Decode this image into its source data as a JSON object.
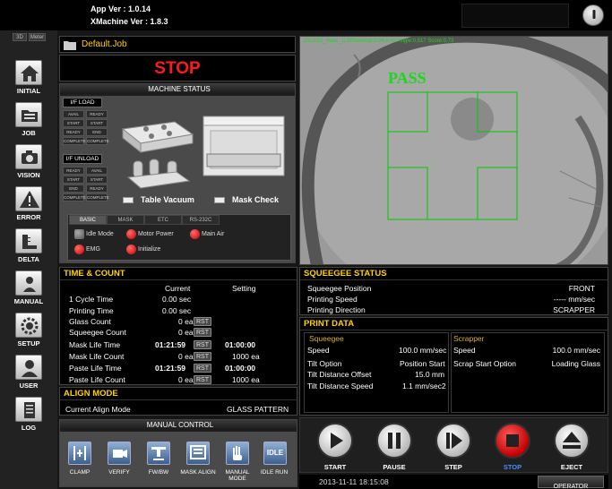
{
  "app": {
    "app_ver": "App Ver : 1.0.14",
    "xmachine_ver": "XMachine Ver : 1.8.3"
  },
  "nav": {
    "mini_tabs": [
      "3D",
      "Meter"
    ],
    "items": [
      {
        "label": "INITIAL",
        "icon": "home-icon"
      },
      {
        "label": "JOB",
        "icon": "folder-icon"
      },
      {
        "label": "VISION",
        "icon": "camera-icon"
      },
      {
        "label": "ERROR",
        "icon": "warning-icon"
      },
      {
        "label": "DELTA",
        "icon": "ruler-icon"
      },
      {
        "label": "MANUAL",
        "icon": "user-manual-icon"
      },
      {
        "label": "SETUP",
        "icon": "gear-icon"
      },
      {
        "label": "USER",
        "icon": "user-icon"
      },
      {
        "label": "LOG",
        "icon": "log-icon"
      }
    ]
  },
  "job": {
    "name": "Default.Job"
  },
  "machine": {
    "state": "STOP",
    "status_title": "MACHINE STATUS",
    "if_load": {
      "title": "I/F LOAD",
      "cells": [
        "AVAIL",
        "READY",
        "START",
        "START",
        "READY",
        "END",
        "COMPLETE",
        "COMPLETE"
      ]
    },
    "if_unload": {
      "title": "I/F UNLOAD",
      "cells": [
        "READY",
        "AVAIL",
        "START",
        "START",
        "END",
        "READY",
        "COMPLETE",
        "COMPLETE"
      ]
    },
    "table_vacuum": "Table Vacuum",
    "mask_check": "Mask Check",
    "tabs": [
      "BASIC",
      "MASK",
      "ETC",
      "RS-232C"
    ],
    "indicators": [
      {
        "label": "Idle Mode",
        "state": "gray"
      },
      {
        "label": "Motor Power",
        "state": "red"
      },
      {
        "label": "Main Air",
        "state": "red"
      },
      {
        "label": "EMG",
        "state": "red"
      },
      {
        "label": "Initialize",
        "state": "red"
      }
    ]
  },
  "vision": {
    "overlay_text": "[GLASS_Mark_1] OffsetAmp:0.04,0.42 Angle:0.517 Score:0.73",
    "result": "PASS"
  },
  "time_count": {
    "title": "TIME & COUNT",
    "col_current": "Current",
    "col_setting": "Setting",
    "rst_label": "RST",
    "rows": [
      {
        "label": "1 Cycle Time",
        "current": "0.00 sec",
        "setting": "",
        "rst": false
      },
      {
        "label": "Printing Time",
        "current": "0.00 sec",
        "setting": "",
        "rst": false
      },
      {
        "label": "Glass Count",
        "current": "0 ea",
        "setting": "",
        "rst": true
      },
      {
        "label": "Squeegee Count",
        "current": "0 ea",
        "setting": "",
        "rst": true
      },
      {
        "label": "Mask Life Time",
        "current": "01:21:59",
        "setting": "01:00:00",
        "rst": true
      },
      {
        "label": "Mask Life Count",
        "current": "0 ea",
        "setting": "1000 ea",
        "rst": true
      },
      {
        "label": "Paste Life Time",
        "current": "01:21:59",
        "setting": "01:00:00",
        "rst": true
      },
      {
        "label": "Paste Life Count",
        "current": "0 ea",
        "setting": "1000 ea",
        "rst": true
      }
    ]
  },
  "align_mode": {
    "title": "ALIGN MODE",
    "label": "Current Align Mode",
    "value": "GLASS PATTERN"
  },
  "manual_control": {
    "title": "MANUAL CONTROL",
    "buttons": [
      {
        "label": "CLAMP",
        "icon": "clamp-icon"
      },
      {
        "label": "VERIFY",
        "icon": "camera-verify-icon"
      },
      {
        "label": "FW/BW",
        "icon": "fw-bw-icon"
      },
      {
        "label": "MASK ALIGN",
        "icon": "mask-align-icon"
      },
      {
        "label": "MANUAL MODE",
        "icon": "hand-icon"
      },
      {
        "label": "IDLE RUN",
        "icon": "idle-run-icon",
        "glyph": "IDLE"
      }
    ]
  },
  "squeegee_status": {
    "title": "SQUEEGEE STATUS",
    "rows": [
      {
        "label": "Squeegee Position",
        "value": "FRONT"
      },
      {
        "label": "Printing Speed",
        "value": "----- mm/sec"
      },
      {
        "label": "Printing Direction",
        "value": "SCRAPPER"
      }
    ]
  },
  "print_data": {
    "title": "PRINT DATA",
    "squeegee_title": "Squeegee",
    "scrapper_title": "Scrapper",
    "squeegee_rows": [
      {
        "label": "Speed",
        "value": "100.0 mm/sec"
      },
      {
        "label": "Tilt Option",
        "value": "Position Start"
      },
      {
        "label": "Tilt Distance Offset",
        "value": "15.0 mm"
      },
      {
        "label": "Tilt Distance Speed",
        "value": "1.1 mm/sec2"
      }
    ],
    "scrapper_rows": [
      {
        "label": "Speed",
        "value": "100.0 mm/sec"
      },
      {
        "label": "Scrap Start Option",
        "value": "Loading Glass"
      }
    ]
  },
  "controls": [
    {
      "label": "START",
      "icon": "play-icon"
    },
    {
      "label": "PAUSE",
      "icon": "pause-icon"
    },
    {
      "label": "STEP",
      "icon": "step-icon"
    },
    {
      "label": "STOP",
      "icon": "stop-icon"
    },
    {
      "label": "EJECT",
      "icon": "eject-icon"
    }
  ],
  "status_bar": {
    "datetime": "2013-11-11 18:15:08",
    "role": "OPERATOR"
  }
}
